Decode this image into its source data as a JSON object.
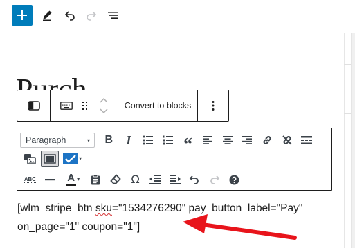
{
  "header": {
    "add_block_icon": "plus-icon",
    "tools_icon": "pencil-icon",
    "undo_icon": "undo-icon",
    "redo_icon": "redo-icon",
    "outline_icon": "list-view-icon"
  },
  "post": {
    "title": "Purch"
  },
  "block_toolbar": {
    "block_type_icon": "classic-block-icon",
    "keyboard_icon": "keyboard-icon",
    "drag_icon": "drag-handle-icon",
    "convert_label": "Convert to blocks",
    "more_icon": "more-options-icon"
  },
  "classic_editor": {
    "format_select": {
      "selected": "Paragraph",
      "caret": "▾"
    },
    "row1_icons": [
      "bold-icon",
      "italic-icon",
      "bullet-list-icon",
      "numbered-list-icon",
      "blockquote-icon",
      "align-left-icon",
      "align-center-icon",
      "align-right-icon",
      "link-icon",
      "unlink-icon",
      "read-more-icon"
    ],
    "row2_icons": [
      "insert-media-icon",
      "keyboard-toggle-icon",
      "checkmark-dropdown-icon"
    ],
    "row3_icons": [
      "spellcheck-icon",
      "horizontal-line-icon",
      "text-color-icon",
      "paste-text-icon",
      "clear-formatting-icon",
      "special-character-icon",
      "outdent-icon",
      "indent-icon",
      "undo-icon",
      "redo-icon",
      "help-icon"
    ],
    "glyphs": {
      "bold": "B",
      "italic": "I",
      "quote": "“",
      "text_color": "A",
      "omega": "Ω",
      "abc": "ABC",
      "caret": "▾"
    }
  },
  "content": {
    "line1_pre": "[wlm_stripe_btn ",
    "line1_misspelled": "sku",
    "line1_post": "=\"1534276290\" pay_button_label=\"Pay\"",
    "line2": "on_page=\"1\" coupon=\"1\"]"
  },
  "colors": {
    "accent": "#007cba",
    "annotation_arrow": "#e8141b",
    "text": "#1e1e1e",
    "toolbar_icon": "#3c434a",
    "checkbox_color": "#1d74c5"
  }
}
